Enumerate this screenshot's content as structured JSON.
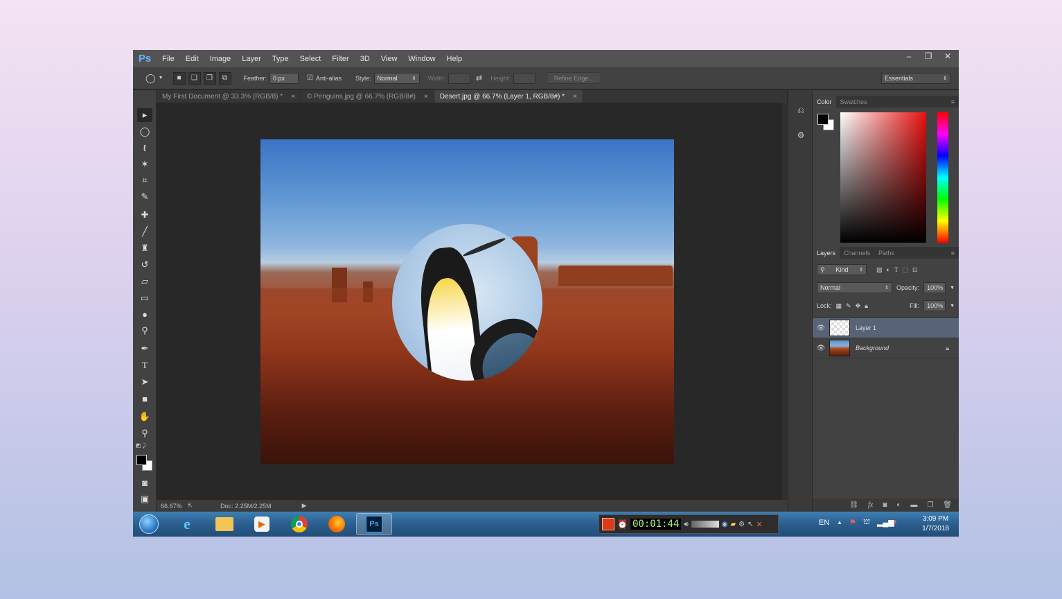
{
  "app": {
    "logo": "Ps"
  },
  "menu": [
    "File",
    "Edit",
    "Image",
    "Layer",
    "Type",
    "Select",
    "Filter",
    "3D",
    "View",
    "Window",
    "Help"
  ],
  "window_controls": {
    "minimize": "–",
    "maximize": "❐",
    "close": "✕"
  },
  "options": {
    "feather_label": "Feather:",
    "feather_value": "0 px",
    "antialias_label": "Anti-alias",
    "style_label": "Style:",
    "style_value": "Normal",
    "width_label": "Width:",
    "height_label": "Height:",
    "refine_edge": "Refine Edge...",
    "workspace": "Essentials"
  },
  "tabs": [
    {
      "label": "My First Document @ 33.3% (RGB/8) *"
    },
    {
      "label": "© Penguins.jpg @ 66.7% (RGB/8#)"
    },
    {
      "label": "Desert.jpg @ 66.7% (Layer 1, RGB/8#) *"
    }
  ],
  "status": {
    "zoom": "66.67%",
    "doc": "Doc: 2.25M/2.25M"
  },
  "color_panel": {
    "tab_color": "Color",
    "tab_swatches": "Swatches",
    "foreground": "#000000",
    "background": "#ffffff"
  },
  "layers_panel": {
    "tabs": [
      "Layers",
      "Channels",
      "Paths"
    ],
    "kind": "Kind",
    "blend_mode": "Normal",
    "opacity_label": "Opacity:",
    "opacity_value": "100%",
    "lock_label": "Lock:",
    "fill_label": "Fill:",
    "fill_value": "100%",
    "layers": [
      {
        "name": "Layer 1",
        "selected": true,
        "visible": true
      },
      {
        "name": "Background",
        "selected": false,
        "visible": true,
        "locked": true
      }
    ]
  },
  "taskbar": {
    "recording_timer": "00:01:44",
    "language": "EN",
    "time": "3:09 PM",
    "date": "1/7/2018"
  }
}
